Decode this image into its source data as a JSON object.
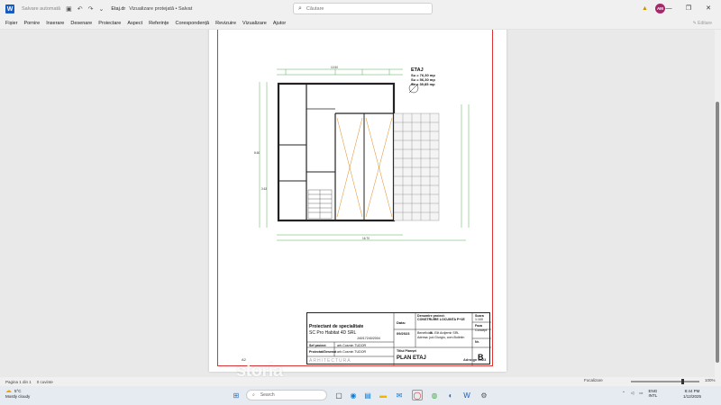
{
  "titlebar": {
    "autosave": "Salvare automată",
    "doc_title": "Etaj.dr",
    "view_state": "Vizualizare protejată • Salvat",
    "search_placeholder": "Căutare",
    "avatar_initials": "AM"
  },
  "menu": [
    "Fișier",
    "Pornire",
    "Inserare",
    "Desenare",
    "Proiectare",
    "Aspect",
    "Referințe",
    "Corespondență",
    "Revizuire",
    "Vizualizare",
    "Ajutor"
  ],
  "editing_label": "✎ Editare",
  "plan": {
    "floor_title": "ETAJ",
    "su": "Su = 76,30 mp",
    "su2": "Su = 56,30 mp",
    "sc": "Sc = 39,85 mp",
    "dim_top": "10.50",
    "dim_total": "16.70",
    "dim_left1": "8.60",
    "dim_left2": "3.63"
  },
  "title_block": {
    "proj_label": "Proiectant de specialitate",
    "company": "SC Pro Habitat 4D SRL",
    "reg_no": "J40/17240/2004",
    "beneficiar_label": "Beneficiar:",
    "beneficiar": "BL Elit Ardjemir SRL",
    "address": "Adresa: jud.Giurgiu, com.Bolintin",
    "date_label": "Data:",
    "date_value": "09/2023",
    "denumire": "Denumire proiect:",
    "constructie": "CONSTRUIRE LOCUINTA P+1E",
    "scara_label": "Scara",
    "scara": "1:100",
    "faza_label": "Faza",
    "faza": "Concept",
    "sef_label": "Sef proiect",
    "sef_name": "arh.Cosmin TUDOR",
    "proiectat_label": "Proiectat/Desenat",
    "proiectat_name": "arh.Cosmin TUDOR",
    "titlu_label": "Titlul Planșei",
    "titlu": "PLAN ETAJ",
    "plansa_label": "Nr.",
    "plansa": "B",
    "arch_word": "ARHITECTURA"
  },
  "footer": {
    "a2": "A2",
    "date": "Adroign 2023",
    "watermark": "storia"
  },
  "statusbar": {
    "page": "Pagina 1 din 1",
    "words": "0 cuvinte",
    "focus": "Focalizare",
    "zoom": "100%"
  },
  "taskbar": {
    "temp": "5°C",
    "weather": "Mostly cloudy",
    "search": "Search",
    "lang1": "ENG",
    "lang2": "INTL",
    "time": "8:44 PM",
    "date": "1/12/2025"
  },
  "colors": {
    "word_blue": "#185abd",
    "frame_red": "#dd3333",
    "avatar": "#a4286a"
  }
}
